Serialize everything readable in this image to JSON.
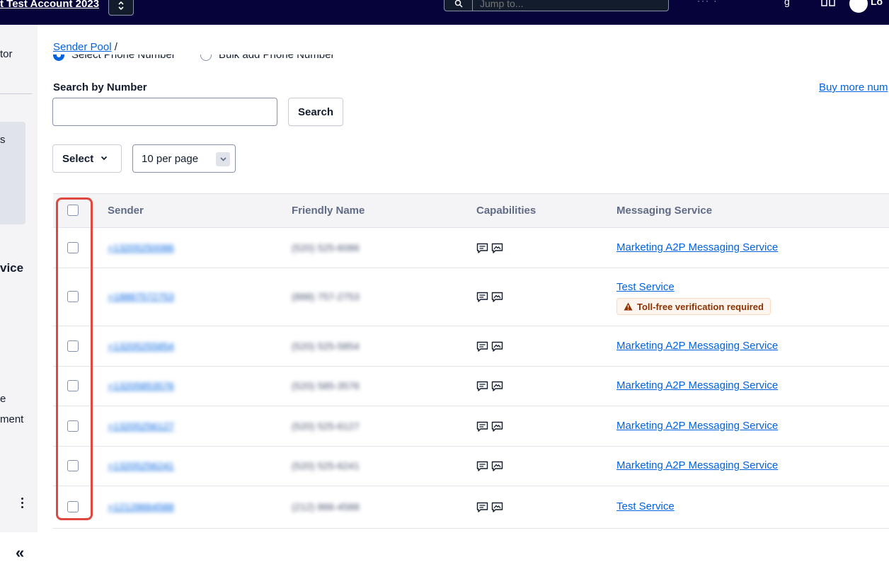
{
  "topbar": {
    "account_name": "t Test Account 2023",
    "search_placeholder": "Jump to...",
    "right_dots": "··· ·",
    "right_g": "g",
    "avatar_text": "Lo"
  },
  "sidebar": {
    "texts": [
      "tor",
      "s",
      "vice",
      "e",
      "ment"
    ]
  },
  "breadcrumb": {
    "link": "Sender Pool",
    "sep": "/"
  },
  "radios": {
    "option1": "Select Phone Number",
    "option2": "Bulk add Phone Number"
  },
  "search": {
    "label": "Search by Number",
    "value": "",
    "button": "Search",
    "buy_link": "Buy more num"
  },
  "controls": {
    "select_label": "Select",
    "per_page": "10 per page"
  },
  "table": {
    "columns": [
      "Sender",
      "Friendly Name",
      "Capabilities",
      "Messaging Service"
    ],
    "rows": [
      {
        "sender": "+13205250086",
        "friendly": "(520) 525-6086",
        "service": "Marketing A2P Messaging Service",
        "warning": ""
      },
      {
        "sender": "+18887572753",
        "friendly": "(888) 757-2753",
        "service": "Test Service",
        "warning": "Toll-free verification required"
      },
      {
        "sender": "+13205255854",
        "friendly": "(520) 525-5854",
        "service": "Marketing A2P Messaging Service",
        "warning": ""
      },
      {
        "sender": "+13205853576",
        "friendly": "(520) 585-3576",
        "service": "Marketing A2P Messaging Service",
        "warning": ""
      },
      {
        "sender": "+13205256127",
        "friendly": "(520) 525-6127",
        "service": "Marketing A2P Messaging Service",
        "warning": ""
      },
      {
        "sender": "+13205256241",
        "friendly": "(520) 525-6241",
        "service": "Marketing A2P Messaging Service",
        "warning": ""
      },
      {
        "sender": "+12128664588",
        "friendly": "(212) 866-4588",
        "service": "Test Service",
        "warning": ""
      }
    ]
  },
  "colors": {
    "topbar": "#06033a",
    "link": "#0263e0",
    "highlight": "#e0483f",
    "warning_text": "#8d3100"
  }
}
